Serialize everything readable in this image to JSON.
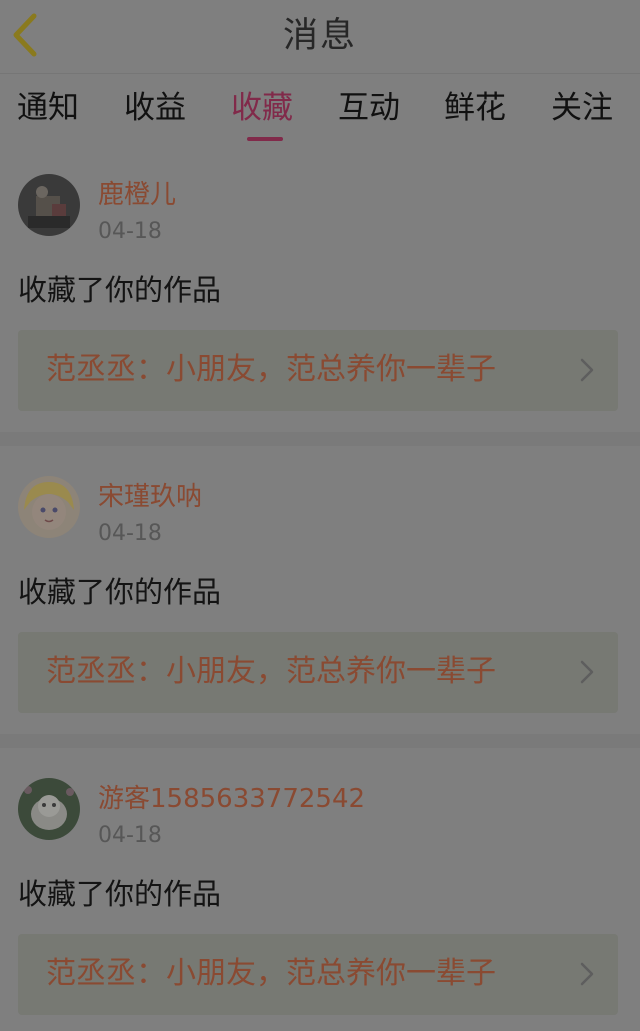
{
  "header": {
    "title": "消息"
  },
  "tabs": [
    {
      "label": "通知"
    },
    {
      "label": "收益"
    },
    {
      "label": "收藏"
    },
    {
      "label": "互动"
    },
    {
      "label": "鲜花"
    },
    {
      "label": "关注"
    }
  ],
  "active_tab": "收藏",
  "messages": [
    {
      "username": "鹿橙儿",
      "time": "04-18",
      "action": "收藏了你的作品",
      "work": "范丞丞：小朋友，范总养你一辈子"
    },
    {
      "username": "宋瑾玖呐",
      "time": "04-18",
      "action": "收藏了你的作品",
      "work": "范丞丞：小朋友，范总养你一辈子"
    },
    {
      "username": "游客1585633772542",
      "time": "04-18",
      "action": "收藏了你的作品",
      "work": "范丞丞：小朋友，范总养你一辈子"
    }
  ],
  "colors": {
    "accent": "#812a4a",
    "link_text": "#8a4a32",
    "overlay_bg": "#7f7f7f",
    "back_arrow": "#8a7a1e"
  }
}
